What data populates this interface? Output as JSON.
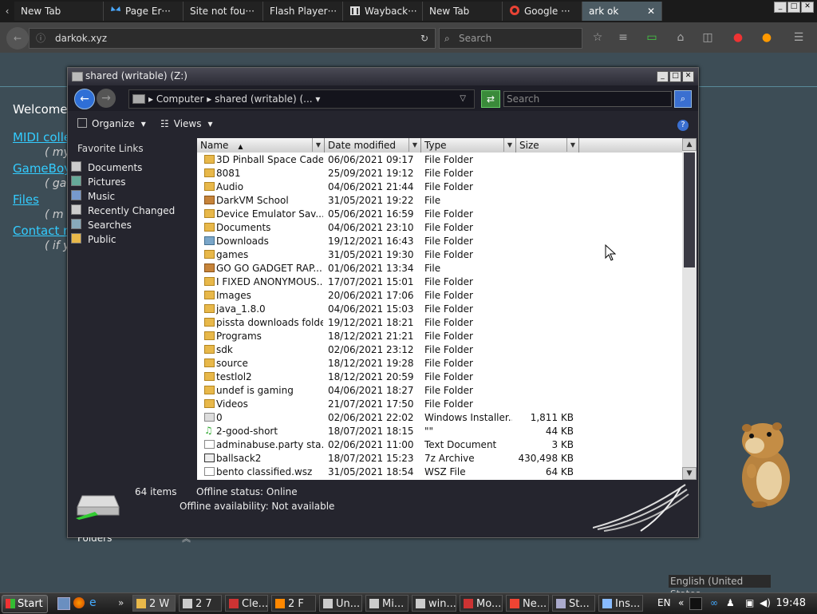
{
  "browser": {
    "tabs": [
      {
        "label": "New Tab",
        "icon": "none"
      },
      {
        "label": "Page Er···",
        "icon": "butterfly-icon"
      },
      {
        "label": "Site not fou···",
        "icon": "none"
      },
      {
        "label": "Flash Player···",
        "icon": "none"
      },
      {
        "label": "Wayback···",
        "icon": "archive-icon"
      },
      {
        "label": "New Tab",
        "icon": "none"
      },
      {
        "label": "Google ···",
        "icon": "google-icon"
      },
      {
        "label": "ark ok",
        "icon": "none"
      }
    ],
    "url": "darkok.xyz",
    "search_placeholder": "Search"
  },
  "webpage": {
    "welcome": "Welcome",
    "links": [
      {
        "label": "MIDI colle",
        "note": "( my"
      },
      {
        "label": "GameBoy",
        "note": "( ga"
      },
      {
        "label": "Files",
        "note": "( m"
      },
      {
        "label": "Contact m",
        "note": "( if y"
      }
    ],
    "locale": "English (United States"
  },
  "explorer": {
    "title": "shared (writable) (Z:)",
    "breadcrumb": "▸ Computer ▸ shared (writable) (... ▾",
    "search_placeholder": "Search",
    "toolbar": {
      "organize": "Organize",
      "views": "Views"
    },
    "favorite_links_header": "Favorite Links",
    "favorite_links": [
      "Documents",
      "Pictures",
      "Music",
      "Recently Changed",
      "Searches",
      "Public"
    ],
    "folders_label": "Folders",
    "columns": {
      "name": "Name",
      "date": "Date modified",
      "type": "Type",
      "size": "Size"
    },
    "files": [
      {
        "name": "3D Pinball Space Cadet",
        "date": "06/06/2021 09:17",
        "type": "File Folder",
        "size": "",
        "icon": "folder"
      },
      {
        "name": "8081",
        "date": "25/09/2021 19:12",
        "type": "File Folder",
        "size": "",
        "icon": "folder"
      },
      {
        "name": "Audio",
        "date": "04/06/2021 21:44",
        "type": "File Folder",
        "size": "",
        "icon": "folder"
      },
      {
        "name": "DarkVM School",
        "date": "31/05/2021 19:22",
        "type": "File",
        "size": "",
        "icon": "package"
      },
      {
        "name": "Device Emulator Sav...",
        "date": "05/06/2021 16:59",
        "type": "File Folder",
        "size": "",
        "icon": "folder"
      },
      {
        "name": "Documents",
        "date": "04/06/2021 23:10",
        "type": "File Folder",
        "size": "",
        "icon": "folder"
      },
      {
        "name": "Downloads",
        "date": "19/12/2021 16:43",
        "type": "File Folder",
        "size": "",
        "icon": "download"
      },
      {
        "name": "games",
        "date": "31/05/2021 19:30",
        "type": "File Folder",
        "size": "",
        "icon": "folder"
      },
      {
        "name": "GO GO GADGET RAP...",
        "date": "01/06/2021 13:34",
        "type": "File",
        "size": "",
        "icon": "package"
      },
      {
        "name": "I FIXED ANONYMOUS...",
        "date": "17/07/2021 15:01",
        "type": "File Folder",
        "size": "",
        "icon": "folder"
      },
      {
        "name": "Images",
        "date": "20/06/2021 17:06",
        "type": "File Folder",
        "size": "",
        "icon": "folder"
      },
      {
        "name": "java_1.8.0",
        "date": "04/06/2021 15:03",
        "type": "File Folder",
        "size": "",
        "icon": "folder"
      },
      {
        "name": "pissta downloads folder",
        "date": "19/12/2021 18:21",
        "type": "File Folder",
        "size": "",
        "icon": "folder"
      },
      {
        "name": "Programs",
        "date": "18/12/2021 21:21",
        "type": "File Folder",
        "size": "",
        "icon": "folder"
      },
      {
        "name": "sdk",
        "date": "02/06/2021 23:12",
        "type": "File Folder",
        "size": "",
        "icon": "folder"
      },
      {
        "name": "source",
        "date": "18/12/2021 19:28",
        "type": "File Folder",
        "size": "",
        "icon": "folder"
      },
      {
        "name": "testlol2",
        "date": "18/12/2021 20:59",
        "type": "File Folder",
        "size": "",
        "icon": "folder"
      },
      {
        "name": "undef is gaming",
        "date": "04/06/2021 18:27",
        "type": "File Folder",
        "size": "",
        "icon": "folder"
      },
      {
        "name": "Videos",
        "date": "21/07/2021 17:50",
        "type": "File Folder",
        "size": "",
        "icon": "folder"
      },
      {
        "name": "0",
        "date": "02/06/2021 22:02",
        "type": "Windows Installer...",
        "size": "1,811 KB",
        "icon": "installer"
      },
      {
        "name": "2-good-short",
        "date": "18/07/2021 18:15",
        "type": "\"\"",
        "size": "44 KB",
        "icon": "music"
      },
      {
        "name": "adminabuse.party sta...",
        "date": "02/06/2021 11:00",
        "type": "Text Document",
        "size": "3 KB",
        "icon": "file"
      },
      {
        "name": "ballsack2",
        "date": "18/07/2021 15:23",
        "type": "7z Archive",
        "size": "430,498 KB",
        "icon": "archive"
      },
      {
        "name": "bento classified.wsz",
        "date": "31/05/2021 18:54",
        "type": "WSZ File",
        "size": "64 KB",
        "icon": "file"
      }
    ],
    "status": {
      "items": "64 items",
      "offline_status": "Offline status: Online",
      "offline_availability": "Offline availability: Not available"
    }
  },
  "taskbar": {
    "start": "Start",
    "tasks": [
      {
        "label": "2 W",
        "icon": "folder-icon"
      },
      {
        "label": "2 7",
        "icon": "window-icon"
      },
      {
        "label": "Cle...",
        "icon": "app-icon"
      },
      {
        "label": "2 F",
        "icon": "firefox-icon"
      },
      {
        "label": "Un...",
        "icon": "window-icon"
      },
      {
        "label": "Mi...",
        "icon": "window-icon"
      },
      {
        "label": "win...",
        "icon": "window-icon"
      },
      {
        "label": "Mo...",
        "icon": "app-icon"
      },
      {
        "label": "Ne...",
        "icon": "chrome-icon"
      },
      {
        "label": "St...",
        "icon": "steam-icon"
      },
      {
        "label": "Ins...",
        "icon": "installer-icon"
      }
    ],
    "language": "EN",
    "clock": "19:48"
  }
}
